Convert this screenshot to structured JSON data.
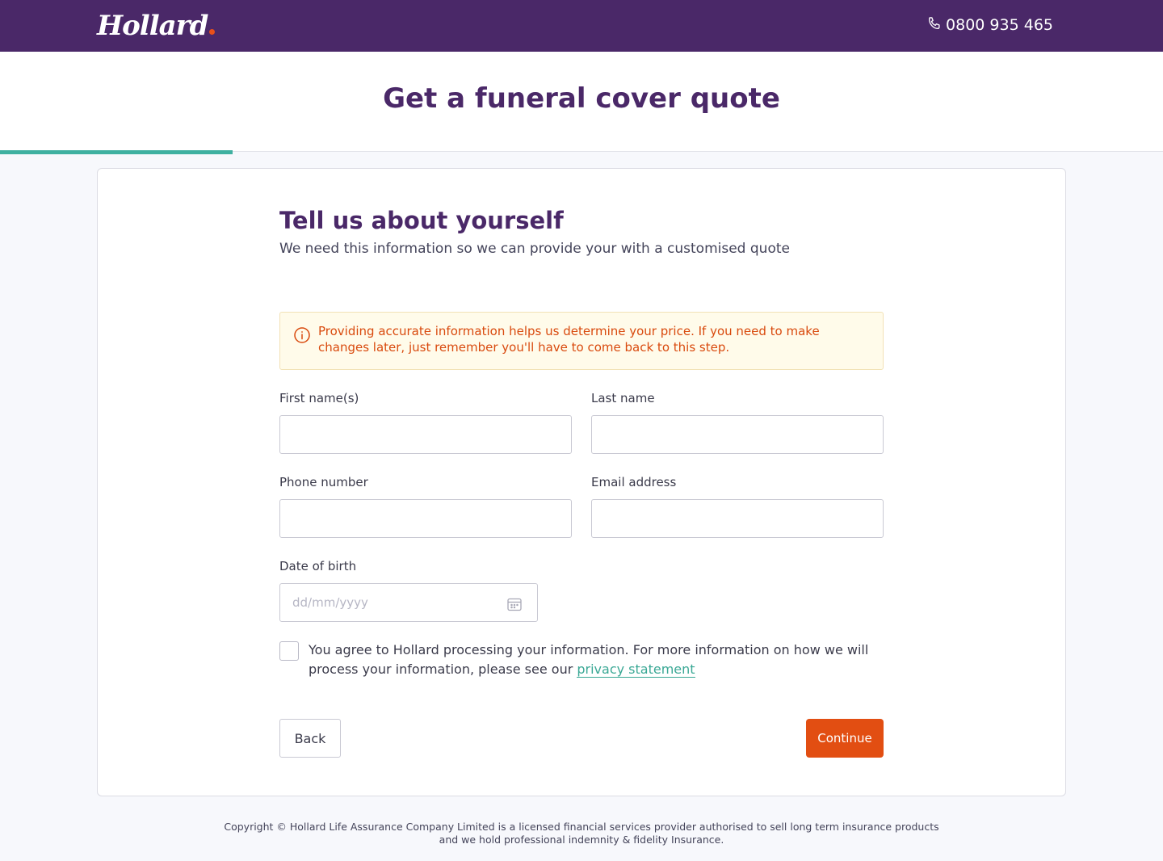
{
  "brand": {
    "name": "Hollard"
  },
  "contact": {
    "phone": "0800 935 465"
  },
  "header": {
    "title": "Get a funeral cover quote"
  },
  "progress": {
    "fraction": 0.2
  },
  "form": {
    "title": "Tell us about yourself",
    "subtitle": "We need this information so we can provide your with a customised quote",
    "notice": "Providing accurate information helps us determine your price. If you need to make changes later, just remember you'll have to come back to this step.",
    "first_name": {
      "label": "First name(s)",
      "value": ""
    },
    "last_name": {
      "label": "Last name",
      "value": ""
    },
    "phone": {
      "label": "Phone number",
      "value": ""
    },
    "email": {
      "label": "Email address",
      "value": ""
    },
    "dob": {
      "label": "Date of birth",
      "placeholder": "dd/mm/yyyy",
      "value": ""
    },
    "consent": {
      "text": "You agree to Hollard processing your information. For more information on how we will process your information, please see our",
      "link": "privacy statement",
      "checked": false
    },
    "back_label": "Back",
    "continue_label": "Continue"
  },
  "footer": {
    "line1": "Copyright © Hollard Life Assurance Company Limited is a licensed financial services provider authorised to sell long term insurance products",
    "line2": "and we hold professional indemnity & fidelity Insurance."
  },
  "colors": {
    "brand_purple": "#4a2868",
    "accent_orange": "#e24e12",
    "progress_teal": "#3fb0a0",
    "link_teal": "#3aa895"
  }
}
